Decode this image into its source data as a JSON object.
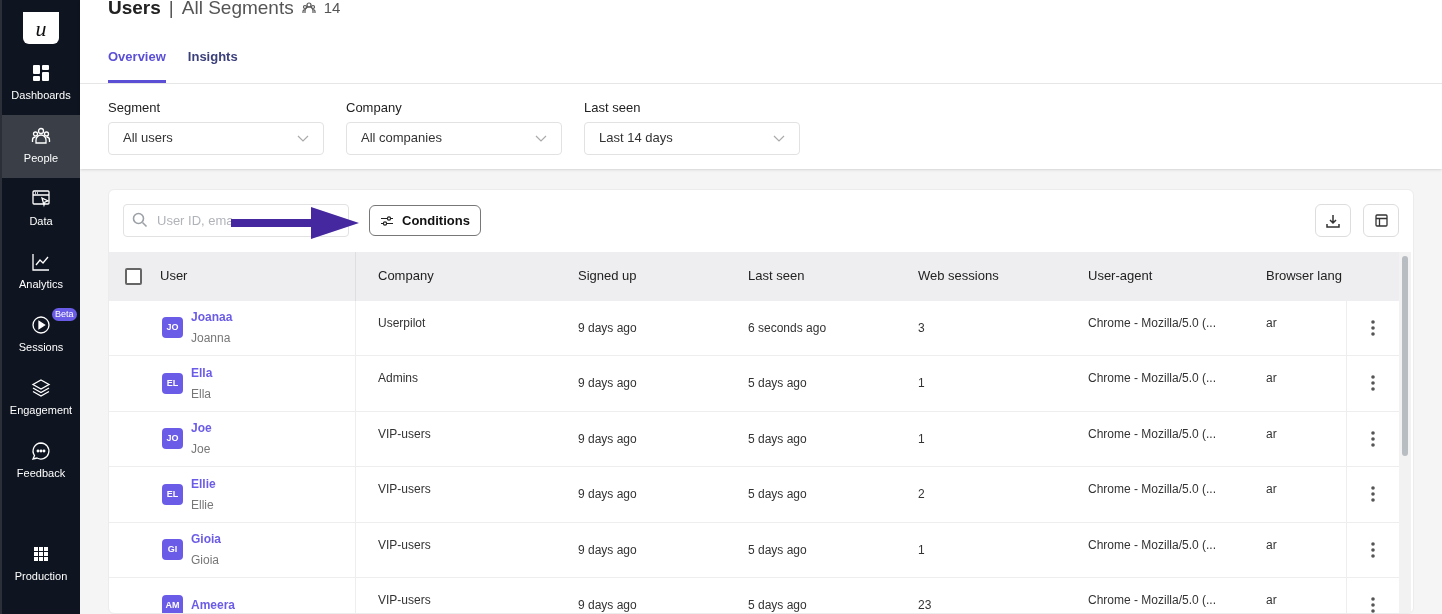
{
  "sidebar": {
    "logo": "u",
    "items": [
      {
        "label": "Dashboards",
        "selected": false
      },
      {
        "label": "People",
        "selected": true
      },
      {
        "label": "Data",
        "selected": false
      },
      {
        "label": "Analytics",
        "selected": false
      },
      {
        "label": "Sessions",
        "selected": false,
        "badge": "Beta"
      },
      {
        "label": "Engagement",
        "selected": false
      },
      {
        "label": "Feedback",
        "selected": false
      }
    ],
    "bottom": {
      "label": "Production"
    }
  },
  "header": {
    "title": "Users",
    "separator": "|",
    "subtitle": "All Segments",
    "count": "14"
  },
  "tabs": [
    {
      "label": "Overview",
      "selected": true
    },
    {
      "label": "Insights",
      "selected": false
    }
  ],
  "filters": [
    {
      "label": "Segment",
      "value": "All users"
    },
    {
      "label": "Company",
      "value": "All companies"
    },
    {
      "label": "Last seen",
      "value": "Last 14 days"
    }
  ],
  "toolbar": {
    "search": {
      "placeholder": "User ID, ema"
    },
    "conditions_button": "Conditions"
  },
  "table": {
    "select_all": {
      "checked": false
    },
    "columns": [
      "User",
      "Company",
      "Signed up",
      "Last seen",
      "Web sessions",
      "User-agent",
      "Browser lang"
    ],
    "rows": [
      {
        "initials": "JO",
        "name": "Joanaa",
        "subname": "Joanna",
        "company": "Userpilot",
        "signed_up": "9 days ago",
        "last_seen": "6 seconds ago",
        "web_sessions": "3",
        "user_agent": "Chrome - Mozilla/5.0 (...",
        "browser_lang": "ar"
      },
      {
        "initials": "EL",
        "name": "Ella",
        "subname": "Ella",
        "company": "Admins",
        "signed_up": "9 days ago",
        "last_seen": "5 days ago",
        "web_sessions": "1",
        "user_agent": "Chrome - Mozilla/5.0 (...",
        "browser_lang": "ar"
      },
      {
        "initials": "JO",
        "name": "Joe",
        "subname": "Joe",
        "company": "VIP-users",
        "signed_up": "9 days ago",
        "last_seen": "5 days ago",
        "web_sessions": "1",
        "user_agent": "Chrome - Mozilla/5.0 (...",
        "browser_lang": "ar"
      },
      {
        "initials": "EL",
        "name": "Ellie",
        "subname": "Ellie",
        "company": "VIP-users",
        "signed_up": "9 days ago",
        "last_seen": "5 days ago",
        "web_sessions": "2",
        "user_agent": "Chrome - Mozilla/5.0 (...",
        "browser_lang": "ar"
      },
      {
        "initials": "GI",
        "name": "Gioia",
        "subname": "Gioia",
        "company": "VIP-users",
        "signed_up": "9 days ago",
        "last_seen": "5 days ago",
        "web_sessions": "1",
        "user_agent": "Chrome - Mozilla/5.0 (...",
        "browser_lang": "ar"
      },
      {
        "initials": "AM",
        "name": "Ameera",
        "company": "VIP-users",
        "signed_up": "9 days ago",
        "last_seen": "5 days ago",
        "web_sessions": "23",
        "user_agent": "Chrome - Mozilla/5.0 (...",
        "browser_lang": "ar"
      }
    ]
  }
}
